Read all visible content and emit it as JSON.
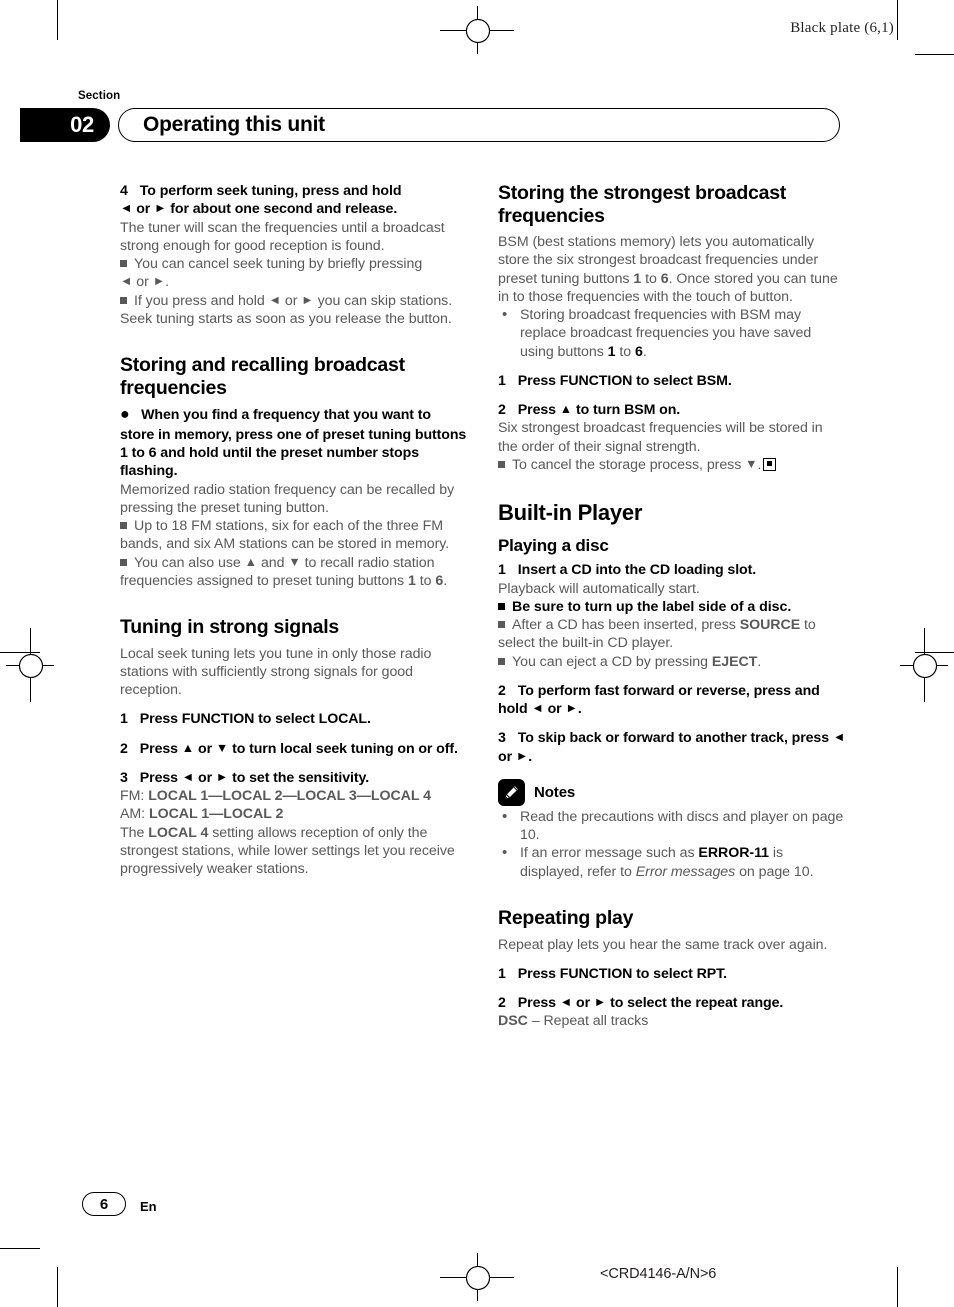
{
  "page": {
    "black_plate": "Black plate (6,1)",
    "section_word": "Section",
    "section_number": "02",
    "section_title": "Operating this unit",
    "page_number": "6",
    "language": "En",
    "part_number": "<CRD4146-A/N>6"
  },
  "left_column": {
    "step4": {
      "num": "4",
      "text_a": "To perform seek tuning, press and hold",
      "arrow_left": "◄",
      "or": "or",
      "arrow_right": "►",
      "text_b": "for about one second and release."
    },
    "step4_body": "The tuner will scan the frequencies until a broadcast strong enough for good reception is found.",
    "step4_note1_a": "You can cancel seek tuning by briefly pressing",
    "step4_note1_b": "or",
    "step4_note1_c": ".",
    "step4_note2_a": "If you press and hold",
    "step4_note2_b": "or",
    "step4_note2_c": "you can skip stations. Seek tuning starts as soon as you release the button.",
    "heading_storing": "Storing and recalling broadcast frequencies",
    "bullet_store": "When you find a frequency that you want to store in memory, press one of preset tuning buttons 1 to 6 and hold until the preset number stops flashing.",
    "store_body": "Memorized radio station frequency can be recalled by pressing the preset tuning button.",
    "store_note1": "Up to 18 FM stations, six for each of the three FM bands, and six AM stations can be stored in memory.",
    "store_note2_a": "You can also use",
    "store_note2_up": "▲",
    "store_note2_and": "and",
    "store_note2_down": "▼",
    "store_note2_b": "to recall radio station frequencies assigned to preset tuning buttons",
    "store_note2_one": "1",
    "store_note2_to": "to",
    "store_note2_six": "6",
    "store_note2_end": ".",
    "heading_tuning": "Tuning in strong signals",
    "tuning_body": "Local seek tuning lets you tune in only those radio stations with sufficiently strong signals for good reception.",
    "tuning_step1_num": "1",
    "tuning_step1": "Press FUNCTION to select LOCAL.",
    "tuning_step2_num": "2",
    "tuning_step2_a": "Press",
    "tuning_step2_up": "▲",
    "tuning_step2_or": "or",
    "tuning_step2_down": "▼",
    "tuning_step2_b": "to turn local seek tuning on or off.",
    "tuning_step3_num": "3",
    "tuning_step3_a": "Press",
    "tuning_step3_left": "◄",
    "tuning_step3_or": "or",
    "tuning_step3_right": "►",
    "tuning_step3_b": "to set the sensitivity.",
    "fm_label": "FM:",
    "fm_values": "LOCAL 1—LOCAL 2—LOCAL 3—LOCAL 4",
    "am_label": "AM:",
    "am_values": "LOCAL 1—LOCAL 2",
    "local_body_a": "The",
    "local_body_bold": "LOCAL 4",
    "local_body_b": "setting allows reception of only the strongest stations, while lower settings let you receive progressively weaker stations."
  },
  "right_column": {
    "heading_bsm": "Storing the strongest broadcast frequencies",
    "bsm_body_a": "BSM (best stations memory) lets you automatically store the six strongest broadcast frequencies under preset tuning buttons",
    "bsm_body_one": "1",
    "bsm_body_to": "to",
    "bsm_body_six": "6",
    "bsm_body_b": ". Once stored you can tune in to those frequencies with the touch of button.",
    "bsm_bullet_a": "Storing broadcast frequencies with BSM may replace broadcast frequencies you have saved using buttons",
    "bsm_bullet_one": "1",
    "bsm_bullet_to": "to",
    "bsm_bullet_six": "6",
    "bsm_bullet_end": ".",
    "bsm_step1_num": "1",
    "bsm_step1": "Press FUNCTION to select BSM.",
    "bsm_step2_num": "2",
    "bsm_step2_a": "Press",
    "bsm_step2_up": "▲",
    "bsm_step2_b": "to turn BSM on.",
    "bsm_step2_body": "Six strongest broadcast frequencies will be stored in the order of their signal strength.",
    "bsm_note_a": "To cancel the storage process, press",
    "bsm_note_down": "▼",
    "bsm_note_b": ".",
    "heading_player": "Built-in Player",
    "heading_playing": "Playing a disc",
    "disc_step1_num": "1",
    "disc_step1": "Insert a CD into the CD loading slot.",
    "disc_step1_body": "Playback will automatically start.",
    "disc_note1": "Be sure to turn up the label side of a disc.",
    "disc_note2_a": "After a CD has been inserted, press",
    "disc_note2_bold": "SOURCE",
    "disc_note2_b": "to select the built-in CD player.",
    "disc_note3_a": "You can eject a CD by pressing",
    "disc_note3_bold": "EJECT",
    "disc_note3_b": ".",
    "disc_step2_num": "2",
    "disc_step2_a": "To perform fast forward or reverse, press and hold",
    "disc_step2_left": "◄",
    "disc_step2_or": "or",
    "disc_step2_right": "►",
    "disc_step2_b": ".",
    "disc_step3_num": "3",
    "disc_step3_a": "To skip back or forward to another track, press",
    "disc_step3_left": "◄",
    "disc_step3_or": "or",
    "disc_step3_right": "►",
    "disc_step3_b": ".",
    "notes_label": "Notes",
    "note_item1": "Read the precautions with discs and player on page 10.",
    "note_item2_a": "If an error message such as",
    "note_item2_bold": "ERROR-11",
    "note_item2_b": "is displayed, refer to",
    "note_item2_italic": "Error messages",
    "note_item2_c": "on page 10.",
    "heading_repeat": "Repeating play",
    "repeat_body": "Repeat play lets you hear the same track over again.",
    "repeat_step1_num": "1",
    "repeat_step1": "Press FUNCTION to select RPT.",
    "repeat_step2_num": "2",
    "repeat_step2_a": "Press",
    "repeat_step2_left": "◄",
    "repeat_step2_or": "or",
    "repeat_step2_right": "►",
    "repeat_step2_b": "to select the repeat range.",
    "repeat_dsc_bold": "DSC",
    "repeat_dsc_text": "– Repeat all tracks"
  }
}
